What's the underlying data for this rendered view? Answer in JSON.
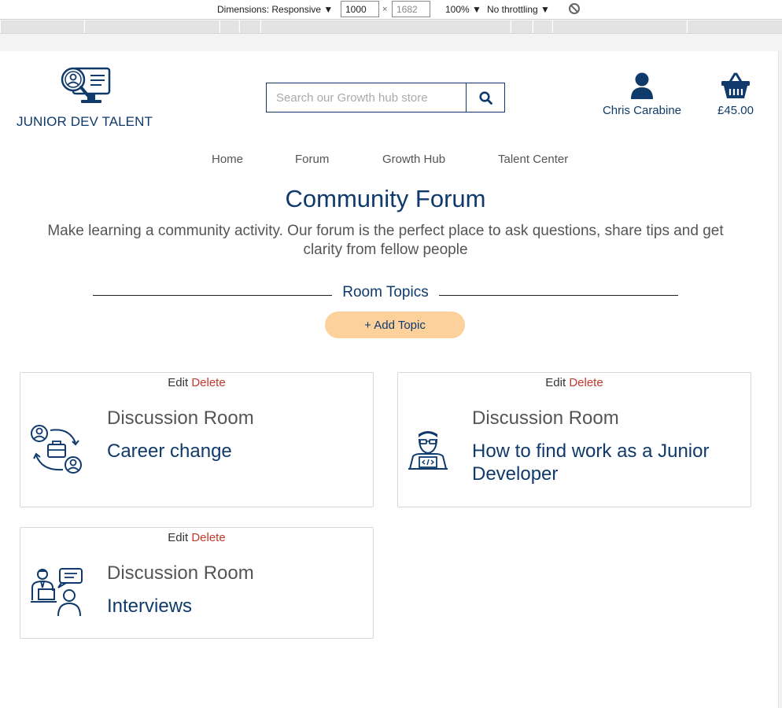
{
  "devtools": {
    "dimensions_label": "Dimensions: Responsive ▼",
    "width": "1000",
    "times": "×",
    "height": "1682",
    "zoom": "100% ▼",
    "throttle": "No throttling ▼"
  },
  "header": {
    "logo_text": "JUNIOR DEV TALENT",
    "search_placeholder": "Search our Growth hub store",
    "account_name": "Chris Carabine",
    "basket_total": "£45.00"
  },
  "nav": {
    "items": [
      "Home",
      "Forum",
      "Growth Hub",
      "Talent Center"
    ]
  },
  "main": {
    "title": "Community Forum",
    "subtitle": "Make learning a community activity. Our forum is the perfect place to ask questions, share tips and get clarity from fellow people",
    "section_label": "Room Topics",
    "add_topic_label": "+ Add Topic"
  },
  "cards": [
    {
      "edit": "Edit",
      "delete": "Delete",
      "room_label": "Discussion Room",
      "topic": "Career change",
      "icon": "career-change-icon"
    },
    {
      "edit": "Edit",
      "delete": "Delete",
      "room_label": "Discussion Room",
      "topic": "How to find work as a Junior Developer",
      "icon": "developer-icon"
    },
    {
      "edit": "Edit",
      "delete": "Delete",
      "room_label": "Discussion Room",
      "topic": "Interviews",
      "icon": "interview-icon"
    }
  ],
  "colors": {
    "brand": "#0f3a6b",
    "accent": "#fcd19c",
    "delete": "#c0392b"
  }
}
